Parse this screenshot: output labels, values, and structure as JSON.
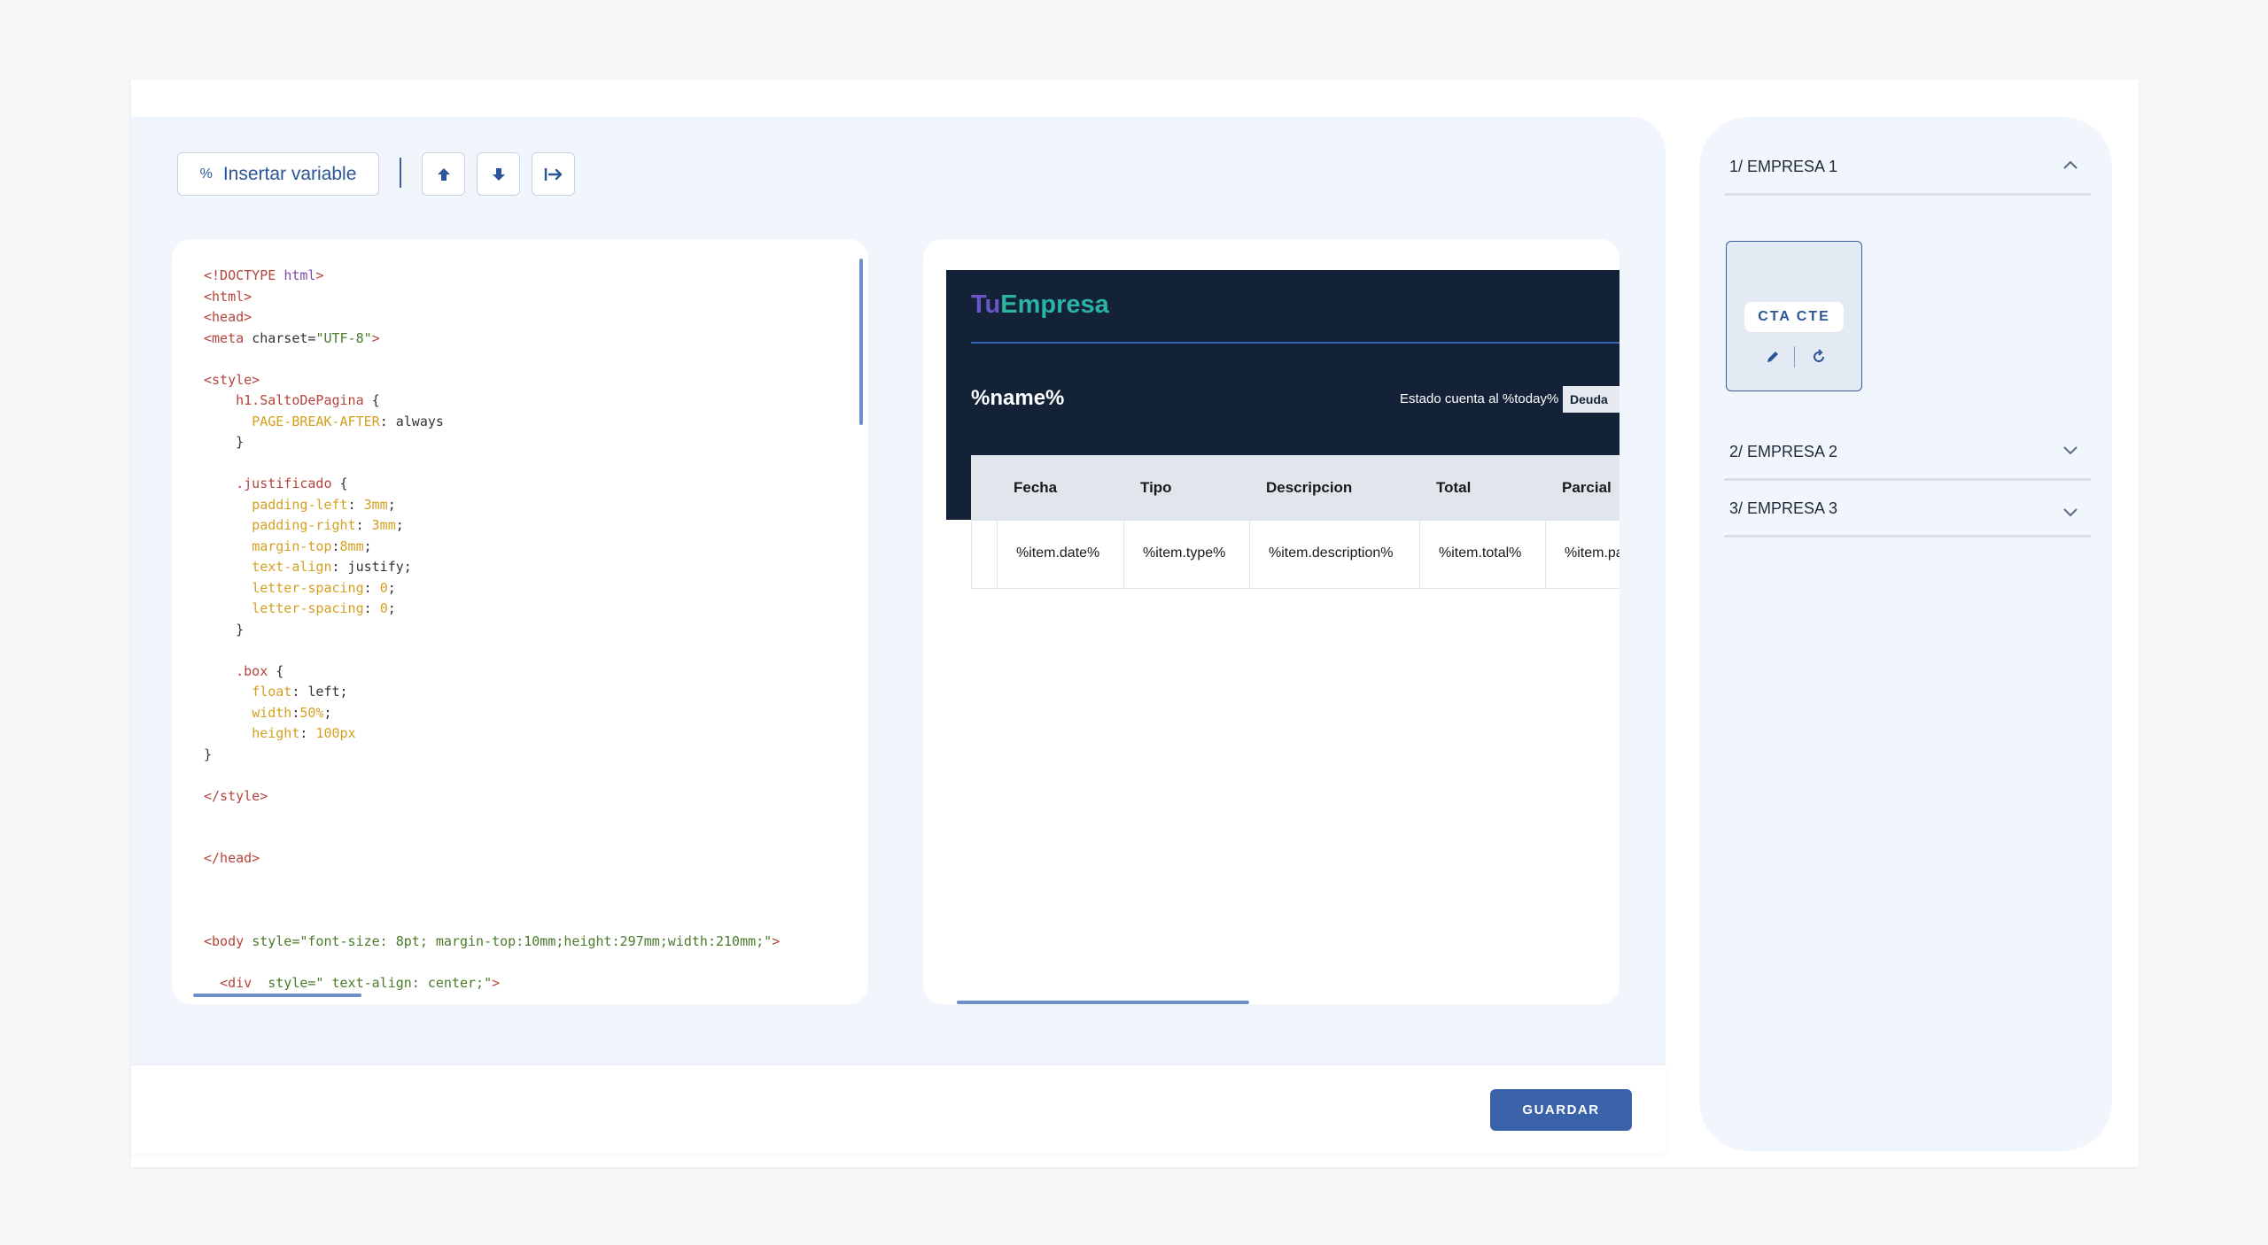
{
  "toolbar": {
    "insert_variable_label": "Insertar variable",
    "insert_variable_icon": "percent-icon",
    "buttons": [
      "arrow-up-icon",
      "arrow-down-icon",
      "indent-icon"
    ]
  },
  "code_lines": [
    [
      [
        "t",
        "<!DOCTYPE "
      ],
      [
        "a",
        "html"
      ],
      [
        "t",
        ">"
      ]
    ],
    [
      [
        "t",
        "<html>"
      ]
    ],
    [
      [
        "t",
        "<head>"
      ]
    ],
    [
      [
        "t",
        "<meta "
      ],
      [
        "x",
        "charset="
      ],
      [
        "s",
        "\"UTF-8\""
      ],
      [
        "t",
        ">"
      ]
    ],
    [
      [
        "x",
        ""
      ]
    ],
    [
      [
        "t",
        "<style>"
      ]
    ],
    [
      [
        "x",
        "    "
      ],
      [
        "c",
        "h1.SaltoDePagina"
      ],
      [
        "x",
        " {"
      ]
    ],
    [
      [
        "x",
        "      "
      ],
      [
        "p",
        "PAGE-BREAK-AFTER"
      ],
      [
        "x",
        ": always"
      ]
    ],
    [
      [
        "x",
        "    }"
      ]
    ],
    [
      [
        "x",
        ""
      ]
    ],
    [
      [
        "x",
        "    "
      ],
      [
        "c",
        ".justificado"
      ],
      [
        "x",
        " {"
      ]
    ],
    [
      [
        "x",
        "      "
      ],
      [
        "p",
        "padding-left"
      ],
      [
        "x",
        ": "
      ],
      [
        "p",
        "3mm"
      ],
      [
        "x",
        ";"
      ]
    ],
    [
      [
        "x",
        "      "
      ],
      [
        "p",
        "padding-right"
      ],
      [
        "x",
        ": "
      ],
      [
        "p",
        "3mm"
      ],
      [
        "x",
        ";"
      ]
    ],
    [
      [
        "x",
        "      "
      ],
      [
        "p",
        "margin-top"
      ],
      [
        "x",
        ":"
      ],
      [
        "p",
        "8mm"
      ],
      [
        "x",
        ";"
      ]
    ],
    [
      [
        "x",
        "      "
      ],
      [
        "p",
        "text-align"
      ],
      [
        "x",
        ": justify;"
      ]
    ],
    [
      [
        "x",
        "      "
      ],
      [
        "p",
        "letter-spacing"
      ],
      [
        "x",
        ": "
      ],
      [
        "p",
        "0"
      ],
      [
        "x",
        ";"
      ]
    ],
    [
      [
        "x",
        "      "
      ],
      [
        "p",
        "letter-spacing"
      ],
      [
        "x",
        ": "
      ],
      [
        "p",
        "0"
      ],
      [
        "x",
        ";"
      ]
    ],
    [
      [
        "x",
        "    }"
      ]
    ],
    [
      [
        "x",
        ""
      ]
    ],
    [
      [
        "x",
        "    "
      ],
      [
        "c",
        ".box"
      ],
      [
        "x",
        " {"
      ]
    ],
    [
      [
        "x",
        "      "
      ],
      [
        "p",
        "float"
      ],
      [
        "x",
        ": left;"
      ]
    ],
    [
      [
        "x",
        "      "
      ],
      [
        "p",
        "width"
      ],
      [
        "x",
        ":"
      ],
      [
        "p",
        "50%"
      ],
      [
        "x",
        ";"
      ]
    ],
    [
      [
        "x",
        "      "
      ],
      [
        "p",
        "height"
      ],
      [
        "x",
        ": "
      ],
      [
        "p",
        "100px"
      ]
    ],
    [
      [
        "x",
        "}"
      ]
    ],
    [
      [
        "x",
        ""
      ]
    ],
    [
      [
        "t",
        "</style>"
      ]
    ],
    [
      [
        "x",
        ""
      ]
    ],
    [
      [
        "x",
        ""
      ]
    ],
    [
      [
        "t",
        "</head>"
      ]
    ],
    [
      [
        "x",
        ""
      ]
    ],
    [
      [
        "x",
        ""
      ]
    ],
    [
      [
        "x",
        ""
      ]
    ],
    [
      [
        "t",
        "<body "
      ],
      [
        "s",
        "style=\"font-size: 8pt; margin-top:10mm;height:297mm;width:210mm;\""
      ],
      [
        "t",
        ">"
      ]
    ],
    [
      [
        "x",
        ""
      ]
    ],
    [
      [
        "x",
        "  "
      ],
      [
        "t",
        "<div  "
      ],
      [
        "s",
        "style=\" text-align: center;\""
      ],
      [
        "t",
        ">"
      ]
    ]
  ],
  "preview": {
    "logo_tu": "Tu",
    "logo_empresa": "Empresa",
    "name": "%name%",
    "estado": "Estado cuenta al %today%",
    "deuda": "Deuda",
    "headers": [
      "Fecha",
      "Tipo",
      "Descripcion",
      "Total",
      "Parcial"
    ],
    "row": [
      "%item.date%",
      "%item.type%",
      "%item.description%",
      "%item.total%",
      "%item.partial%"
    ]
  },
  "footer": {
    "save_label": "GUARDAR"
  },
  "sidebar": {
    "companies": [
      {
        "label": "1/ EMPRESA 1",
        "expanded": true
      },
      {
        "label": "2/ EMPRESA 2",
        "expanded": false
      },
      {
        "label": "3/ EMPRESA 3",
        "expanded": false
      }
    ],
    "template_tile": {
      "label": "CTA CTE",
      "actions": [
        "pencil-icon",
        "refresh-icon"
      ]
    }
  }
}
